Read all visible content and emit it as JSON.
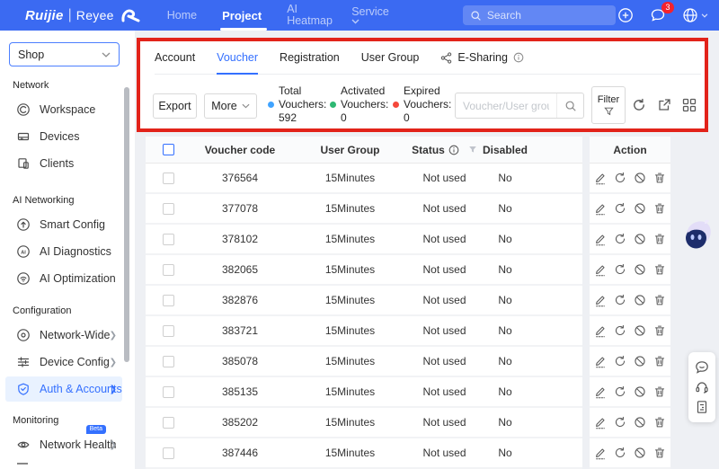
{
  "colors": {
    "nav_blue": "#3b6af2",
    "accent": "#3470ff",
    "annotation_red": "#e2231a"
  },
  "topnav": {
    "logo": {
      "brand": "Ruijie",
      "separator": "|",
      "sub": "Reyee"
    },
    "items": [
      {
        "label": "Home",
        "active": false
      },
      {
        "label": "Project",
        "active": true
      },
      {
        "label": "AI Heatmap",
        "active": false
      },
      {
        "label": "Service",
        "active": false,
        "dropdown": true
      }
    ],
    "search_placeholder": "Search",
    "notification_count": "3",
    "right_icons": [
      "plus-circle-icon",
      "chat-bubble-icon",
      "globe-icon"
    ]
  },
  "sidebar": {
    "org_selector": {
      "value": "Shop"
    },
    "sections": [
      {
        "label": "Network",
        "items": [
          {
            "label": "Workspace",
            "icon": "workspace-icon"
          },
          {
            "label": "Devices",
            "icon": "devices-icon"
          },
          {
            "label": "Clients",
            "icon": "clients-icon"
          }
        ]
      },
      {
        "label": "AI Networking",
        "items": [
          {
            "label": "Smart Config",
            "icon": "smart-config-icon"
          },
          {
            "label": "AI Diagnostics",
            "icon": "ai-diagnostics-icon"
          },
          {
            "label": "AI Optimization",
            "icon": "ai-optimization-icon"
          }
        ]
      },
      {
        "label": "Configuration",
        "items": [
          {
            "label": "Network-Wide",
            "icon": "network-wide-icon",
            "chevron": true
          },
          {
            "label": "Device Config",
            "icon": "device-config-icon",
            "chevron": true
          },
          {
            "label": "Auth & Accounts",
            "icon": "auth-accounts-icon",
            "chevron": true,
            "active": true
          }
        ]
      },
      {
        "label": "Monitoring",
        "items": [
          {
            "label": "Network Health",
            "icon": "network-health-icon",
            "chevron": true,
            "badge": "Beta"
          }
        ]
      }
    ]
  },
  "tabs": [
    "Account",
    "Voucher",
    "Registration",
    "User Group",
    "E-Sharing"
  ],
  "active_tab": "Voucher",
  "toolbar": {
    "export_label": "Export",
    "more_label": "More",
    "stats": [
      {
        "label": "Total Vouchers:",
        "value": "592",
        "color": "#40a3ff"
      },
      {
        "label": "Activated Vouchers:",
        "value": "0",
        "color": "#2eb872"
      },
      {
        "label": "Expired Vouchers:",
        "value": "0",
        "color": "#f5483b"
      }
    ],
    "search_placeholder": "Voucher/User group",
    "filter_label": "Filter",
    "icons": [
      "refresh-icon",
      "export-out-icon",
      "grid-view-icon"
    ]
  },
  "table": {
    "columns": [
      "Voucher code",
      "User Group",
      "Status",
      "Disabled",
      "Action"
    ],
    "action_icons": [
      "edit-icon",
      "renew-icon",
      "ban-icon",
      "delete-icon"
    ],
    "rows": [
      {
        "code": "376564",
        "group": "15Minutes",
        "status": "Not used",
        "disabled": "No"
      },
      {
        "code": "377078",
        "group": "15Minutes",
        "status": "Not used",
        "disabled": "No"
      },
      {
        "code": "378102",
        "group": "15Minutes",
        "status": "Not used",
        "disabled": "No"
      },
      {
        "code": "382065",
        "group": "15Minutes",
        "status": "Not used",
        "disabled": "No"
      },
      {
        "code": "382876",
        "group": "15Minutes",
        "status": "Not used",
        "disabled": "No"
      },
      {
        "code": "383721",
        "group": "15Minutes",
        "status": "Not used",
        "disabled": "No"
      },
      {
        "code": "385078",
        "group": "15Minutes",
        "status": "Not used",
        "disabled": "No"
      },
      {
        "code": "385135",
        "group": "15Minutes",
        "status": "Not used",
        "disabled": "No"
      },
      {
        "code": "385202",
        "group": "15Minutes",
        "status": "Not used",
        "disabled": "No"
      },
      {
        "code": "387446",
        "group": "15Minutes",
        "status": "Not used",
        "disabled": "No"
      }
    ]
  },
  "floating": {
    "side_icons": [
      "chat-smile-icon",
      "headset-icon",
      "feedback-icon"
    ],
    "assistant": "ai-mascot"
  }
}
